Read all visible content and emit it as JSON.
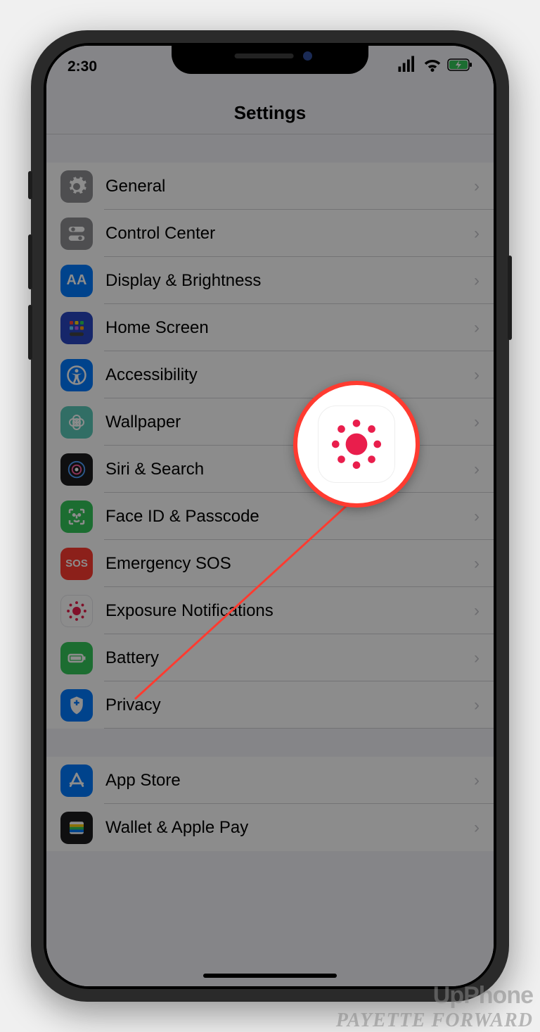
{
  "status": {
    "time": "2:30"
  },
  "header": {
    "title": "Settings"
  },
  "rows": {
    "general": "General",
    "control_center": "Control Center",
    "display": "Display & Brightness",
    "home_screen": "Home Screen",
    "accessibility": "Accessibility",
    "wallpaper": "Wallpaper",
    "siri": "Siri & Search",
    "faceid": "Face ID & Passcode",
    "sos": "Emergency SOS",
    "sos_icon": "SOS",
    "exposure": "Exposure Notifications",
    "battery": "Battery",
    "privacy": "Privacy",
    "appstore": "App Store",
    "wallet": "Wallet & Apple Pay"
  },
  "display_icon": "AA",
  "watermark": {
    "line1": "UpPhone",
    "line2": "PAYETTE FORWARD"
  }
}
